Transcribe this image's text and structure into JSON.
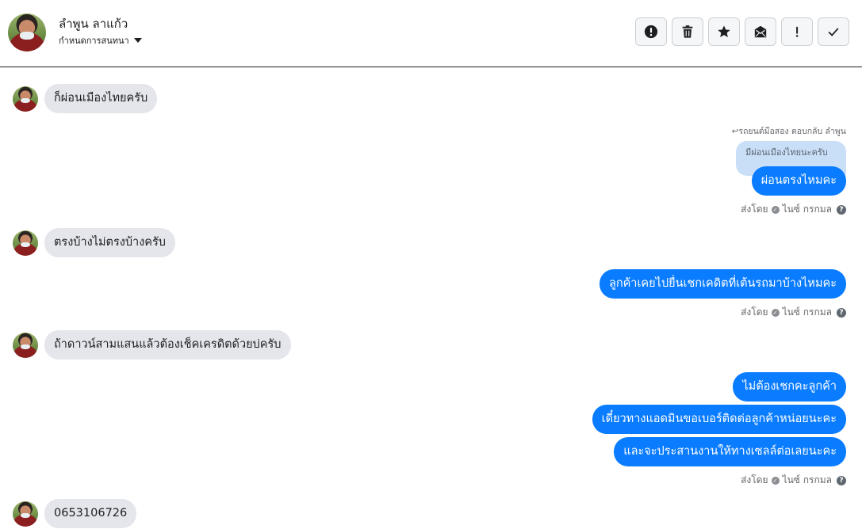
{
  "header": {
    "contact_name": "ลำพูน ลาแก้ว",
    "manage_label": "กำหนดการสนทนา",
    "toolbar": [
      {
        "name": "report-button",
        "icon": "exclamation-circle-icon"
      },
      {
        "name": "delete-button",
        "icon": "trash-icon"
      },
      {
        "name": "star-button",
        "icon": "star-icon"
      },
      {
        "name": "mark-unread-button",
        "icon": "envelope-icon"
      },
      {
        "name": "important-button",
        "icon": "exclamation-icon"
      },
      {
        "name": "done-button",
        "icon": "checkmark-icon"
      }
    ]
  },
  "messages": {
    "m1": "ก็ผ่อนเมืองไทยครับ",
    "reply_label": "↩รถยนต์มือสอง ตอบกลับ ลำพูน",
    "quote": "มีผ่อนเมืองไทยนะครับ",
    "m2": "ผ่อนตรงไหมคะ",
    "sent_by_1": "ส่งโดย",
    "sender_1": "ไนซ์ กรกมล",
    "m3": "ตรงบ้างไม่ตรงบ้างครับ",
    "m4": "ลูกค้าเคยไปยื่นเชกเคดิตที่เต้นรถมาบ้างไหมคะ",
    "sent_by_2": "ส่งโดย",
    "sender_2": "ไนซ์ กรกมล",
    "m5": "ถ้าดาวน์สามแสนแล้วต้องเช็คเครดิตด้วยบ่ครับ",
    "m6": "ไม่ต้องเชกคะลูกค้า",
    "m7": "เดี๋ยวทางแอดมินขอเบอร์ติดต่อลูกค้าหน่อยนะคะ",
    "m8": "และจะประสานงานให้ทางเซลล์ต่อเลยนะคะ",
    "sent_by_3": "ส่งโดย",
    "sender_3": "ไนซ์ กรกมล",
    "m9": "0653106726"
  },
  "colors": {
    "outgoing_bubble": "#0a7cff",
    "incoming_bubble": "#e4e6eb",
    "quote_bubble": "#c9def7"
  }
}
